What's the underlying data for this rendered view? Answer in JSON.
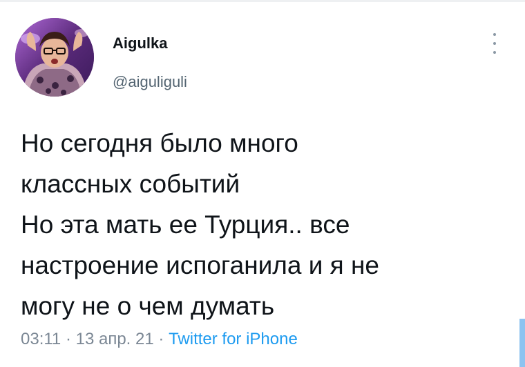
{
  "tweet": {
    "author_name": "Aigulka",
    "author_handle": "@aiguliguli",
    "text_lines": [
      "Но сегодня было много",
      "классных событий",
      "Но эта мать ее Турция.. все",
      "настроение испоганила и я не",
      "могу не о чем думать"
    ],
    "time": "03:11",
    "separator": "·",
    "date": "13 апр. 21",
    "source": "Twitter for iPhone"
  },
  "icons": {
    "more": "more-vertical-icon",
    "avatar": "avatar-image"
  },
  "colors": {
    "text": "#0f1419",
    "secondary": "#536471",
    "link": "#1d9bf0"
  }
}
